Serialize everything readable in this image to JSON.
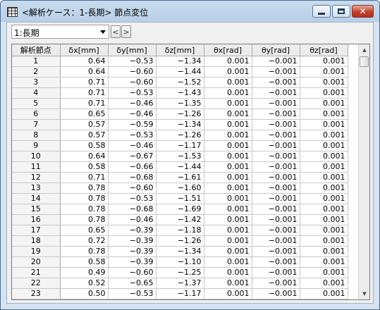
{
  "window": {
    "title": "<解析ケース：1-長期> 節点変位",
    "icons": {
      "app": "table-icon",
      "minimize": "minimize-icon",
      "maximize": "maximize-icon",
      "close": "close-icon"
    },
    "close_glyph": "✕"
  },
  "toolbar": {
    "case_select_value": "1:長期",
    "prev_glyph": "<",
    "next_glyph": ">"
  },
  "table": {
    "columns": [
      "解析節点",
      "δx[mm]",
      "δy[mm]",
      "δz[mm]",
      "θx[rad]",
      "θy[rad]",
      "θz[rad]"
    ],
    "rows": [
      [
        "1",
        "0.64",
        "−0.53",
        "−1.34",
        "0.001",
        "−0.001",
        "0.001"
      ],
      [
        "2",
        "0.64",
        "−0.60",
        "−1.44",
        "0.001",
        "−0.001",
        "0.001"
      ],
      [
        "3",
        "0.71",
        "−0.60",
        "−1.52",
        "0.001",
        "−0.001",
        "0.001"
      ],
      [
        "4",
        "0.71",
        "−0.53",
        "−1.43",
        "0.001",
        "−0.001",
        "0.001"
      ],
      [
        "5",
        "0.71",
        "−0.46",
        "−1.35",
        "0.001",
        "−0.001",
        "0.001"
      ],
      [
        "6",
        "0.65",
        "−0.46",
        "−1.26",
        "0.001",
        "−0.001",
        "0.001"
      ],
      [
        "7",
        "0.57",
        "−0.59",
        "−1.34",
        "0.001",
        "−0.001",
        "0.001"
      ],
      [
        "8",
        "0.57",
        "−0.53",
        "−1.26",
        "0.001",
        "−0.001",
        "0.001"
      ],
      [
        "9",
        "0.58",
        "−0.46",
        "−1.17",
        "0.001",
        "−0.001",
        "0.001"
      ],
      [
        "10",
        "0.64",
        "−0.67",
        "−1.53",
        "0.001",
        "−0.001",
        "0.001"
      ],
      [
        "11",
        "0.58",
        "−0.66",
        "−1.44",
        "0.001",
        "−0.001",
        "0.001"
      ],
      [
        "12",
        "0.71",
        "−0.68",
        "−1.61",
        "0.001",
        "−0.001",
        "0.001"
      ],
      [
        "13",
        "0.78",
        "−0.60",
        "−1.60",
        "0.001",
        "−0.001",
        "0.001"
      ],
      [
        "14",
        "0.78",
        "−0.53",
        "−1.51",
        "0.001",
        "−0.001",
        "0.001"
      ],
      [
        "15",
        "0.78",
        "−0.68",
        "−1.69",
        "0.001",
        "−0.001",
        "0.001"
      ],
      [
        "16",
        "0.78",
        "−0.46",
        "−1.42",
        "0.001",
        "−0.001",
        "0.001"
      ],
      [
        "17",
        "0.65",
        "−0.39",
        "−1.18",
        "0.001",
        "−0.001",
        "0.001"
      ],
      [
        "18",
        "0.72",
        "−0.39",
        "−1.26",
        "0.001",
        "−0.001",
        "0.001"
      ],
      [
        "19",
        "0.78",
        "−0.39",
        "−1.34",
        "0.001",
        "−0.001",
        "0.001"
      ],
      [
        "20",
        "0.58",
        "−0.39",
        "−1.10",
        "0.001",
        "−0.001",
        "0.001"
      ],
      [
        "21",
        "0.49",
        "−0.60",
        "−1.25",
        "0.001",
        "−0.001",
        "0.001"
      ],
      [
        "22",
        "0.52",
        "−0.65",
        "−1.37",
        "0.001",
        "−0.001",
        "0.001"
      ],
      [
        "23",
        "0.50",
        "−0.53",
        "−1.17",
        "0.001",
        "−0.001",
        "0.001"
      ]
    ]
  },
  "scrollbar": {
    "up_glyph": "▲",
    "down_glyph": "▼"
  }
}
